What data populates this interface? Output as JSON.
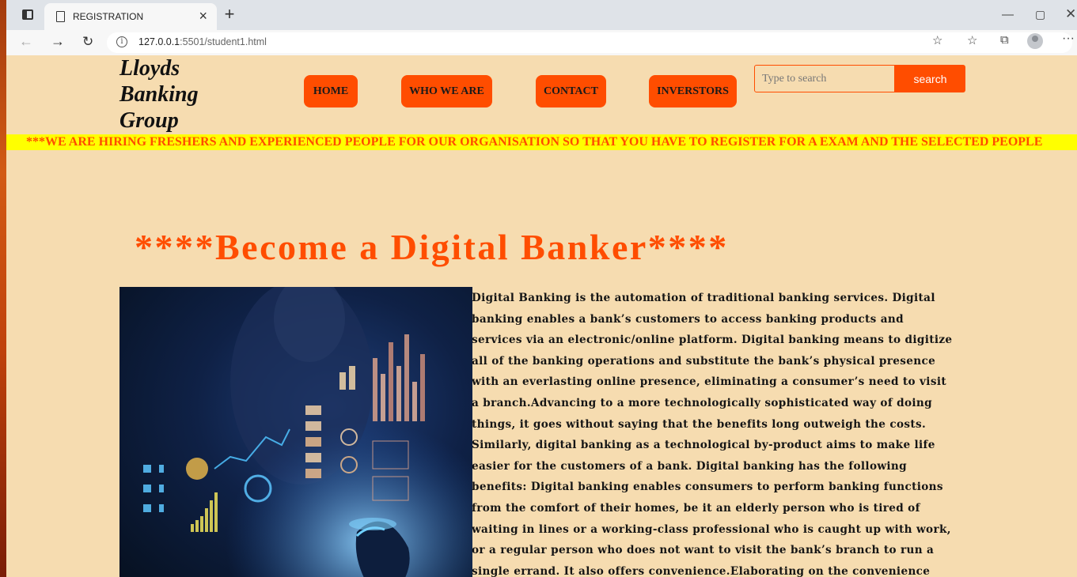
{
  "browser": {
    "tab_title": "REGISTRATION",
    "url_host": "127.0.0.1",
    "url_rest": ":5501/student1.html",
    "icons": [
      "tab-actions-icon",
      "page-icon",
      "close-icon",
      "new-tab-icon",
      "minimize-icon",
      "maximize-icon",
      "close-window-icon",
      "back-icon",
      "forward-icon",
      "reload-icon",
      "info-icon",
      "favorite-add-icon",
      "favorites-icon",
      "collections-icon",
      "profile-icon",
      "more-icon"
    ]
  },
  "header": {
    "logo_line1": "Lloyds",
    "logo_line2": "Banking",
    "logo_line3": "Group",
    "nav": [
      {
        "label": "HOME"
      },
      {
        "label": "WHO WE ARE"
      },
      {
        "label": "CONTACT"
      },
      {
        "label": "INVERSTORS"
      }
    ],
    "search_placeholder": "Type to search",
    "search_button": "search"
  },
  "marquee": "***WE ARE HIRING FRESHERS AND EXPERIENCED PEOPLE FOR OUR ORGANISATION SO THAT YOU HAVE TO REGISTER FOR A EXAM AND THE SELECTED PEOPLE",
  "main": {
    "heading": "****Become a Digital Banker****",
    "hero_image": "digital-banking-hologram-image",
    "paragraph": "Digital Banking is the automation of traditional banking services. Digital banking enables a bank’s customers to access banking products and services via an electronic/online platform. Digital banking means to digitize all of the banking operations and substitute the bank’s physical presence with an everlasting online presence, eliminating a consumer’s need to visit a branch.Advancing to a more technologically sophisticated way of doing things, it goes without saying that the benefits long outweigh the costs. Similarly, digital banking as a technological by-product aims to make life easier for the customers of a bank. Digital banking has the following benefits: Digital banking enables consumers to perform banking functions from the comfort of their homes, be it an elderly person who is tired of waiting in lines or a working-class professional who is caught up with work, or a regular person who does not want to visit the bank’s branch to run a single errand. It also offers convenience.Elaborating on the convenience offered, digital banking lets"
  },
  "colors": {
    "accent": "#ff4d00",
    "page_bg": "#f6dcb0",
    "marquee_bg": "#ffff00"
  }
}
